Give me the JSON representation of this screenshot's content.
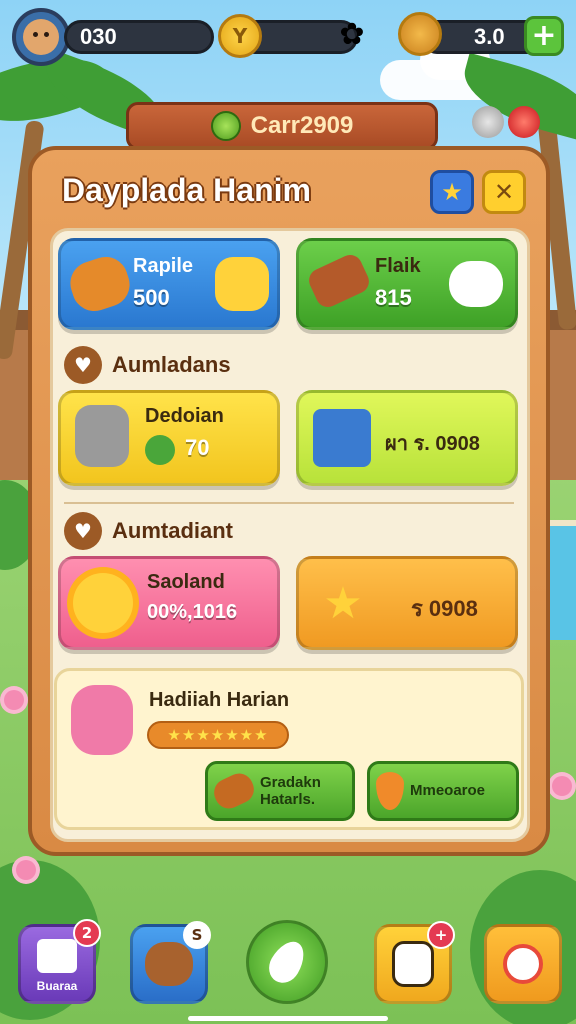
{
  "hud": {
    "level_value": "030",
    "coin_icon": "coin-icon",
    "flower_icon": "flower-icon",
    "nut_icon": "walnut-icon",
    "nut_value": "3.0",
    "plus_label": "+"
  },
  "banner": {
    "label": "Carr2909",
    "icon": "seed-icon"
  },
  "panel": {
    "title": "Dayplada Hanim",
    "star_label": "★",
    "close_label": "✕"
  },
  "cards_top": [
    {
      "title": "Rapile",
      "value": "500",
      "icon": "bread-icon",
      "icon2": "duck-icon",
      "color": "#3a8ee6"
    },
    {
      "title": "Flaik",
      "value": "815",
      "icon": "log-icon",
      "icon2": "cloud-icon",
      "color": "#56b33a"
    }
  ],
  "section1": {
    "label": "Aumladans",
    "icon": "heart-icon"
  },
  "cards_mid": [
    {
      "title": "Dedoian",
      "value": "70",
      "icon": "vacuum-icon",
      "icon2": "apple-icon",
      "color": "#f7d83a"
    },
    {
      "title": "",
      "value": "ผา ร. 0908",
      "icon": "book-icon",
      "color": "#c9ee4a"
    }
  ],
  "section2": {
    "label": "Aumtadiant",
    "icon": "heart-icon"
  },
  "cards_low": [
    {
      "title": "Saoland",
      "value": "00%,1016",
      "icon": "sun-icon",
      "color": "#f5749b"
    },
    {
      "title": "",
      "value": "ร 0908",
      "icon": "wood-star-icon",
      "color": "#f5a43a"
    }
  ],
  "reward": {
    "title": "Hadiiah Harian",
    "stars": "★★★★★★★",
    "icon": "bunny-icon",
    "btn1": "Gradakn\nHatarls.",
    "btn1_icon": "bread-icon",
    "btn2": "Mmeoaroe",
    "btn2_icon": "carrot-icon"
  },
  "bottom_nav": [
    {
      "label": "Buaraa",
      "icon": "house-icon",
      "badge": "2"
    },
    {
      "label": "",
      "icon": "bear-icon",
      "badge": "S"
    },
    {
      "label": "",
      "icon": "leaf-icon",
      "badge": ""
    },
    {
      "label": "",
      "icon": "panda-icon",
      "badge": "+"
    },
    {
      "label": "",
      "icon": "dog-icon",
      "badge": ""
    }
  ]
}
